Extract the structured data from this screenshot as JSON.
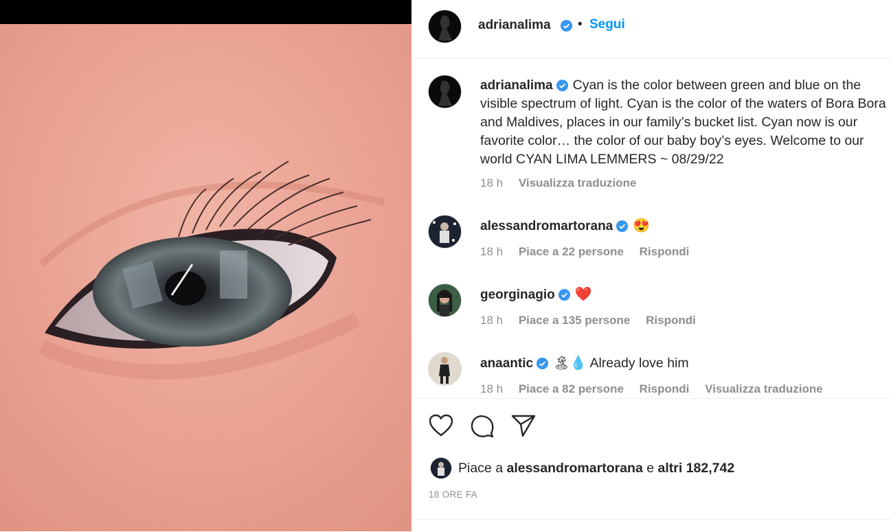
{
  "post": {
    "author": "adrianalima",
    "follow_label": "Segui",
    "separator": "•",
    "more": "⋮"
  },
  "caption": {
    "username": "adrianalima",
    "text": "Cyan is the color between green and blue on the visible spectrum of light. Cyan is the color of the waters of Bora Bora and Maldives, places in our family’s bucket list. Cyan now is our favorite color… the color of our baby boy’s eyes. Welcome to our world CYAN LIMA LEMMERS ~ 08/29/22",
    "time": "18 h",
    "translate": "Visualizza traduzione"
  },
  "comments": [
    {
      "username": "alessandromartorana",
      "text": "😍",
      "time": "18 h",
      "likes": "Piace a 22 persone",
      "reply": "Rispondi",
      "translate": ""
    },
    {
      "username": "georginagio",
      "text": "❤️",
      "time": "18 h",
      "likes": "Piace a 135 persone",
      "reply": "Rispondi",
      "translate": ""
    },
    {
      "username": "anaantic",
      "text": "🏝💧 Already love him",
      "time": "18 h",
      "likes": "Piace a 82 persone",
      "reply": "Rispondi",
      "translate": "Visualizza traduzione"
    }
  ],
  "likes_line": {
    "prefix": "Piace a",
    "user": "alessandromartorana",
    "conj": "e",
    "others": "altri 182,742"
  },
  "timestamp": "18 ORE FA",
  "colors": {
    "accent": "#0095f6",
    "verified": "#3897f0",
    "text": "#262626",
    "muted": "#8e8e8e"
  }
}
